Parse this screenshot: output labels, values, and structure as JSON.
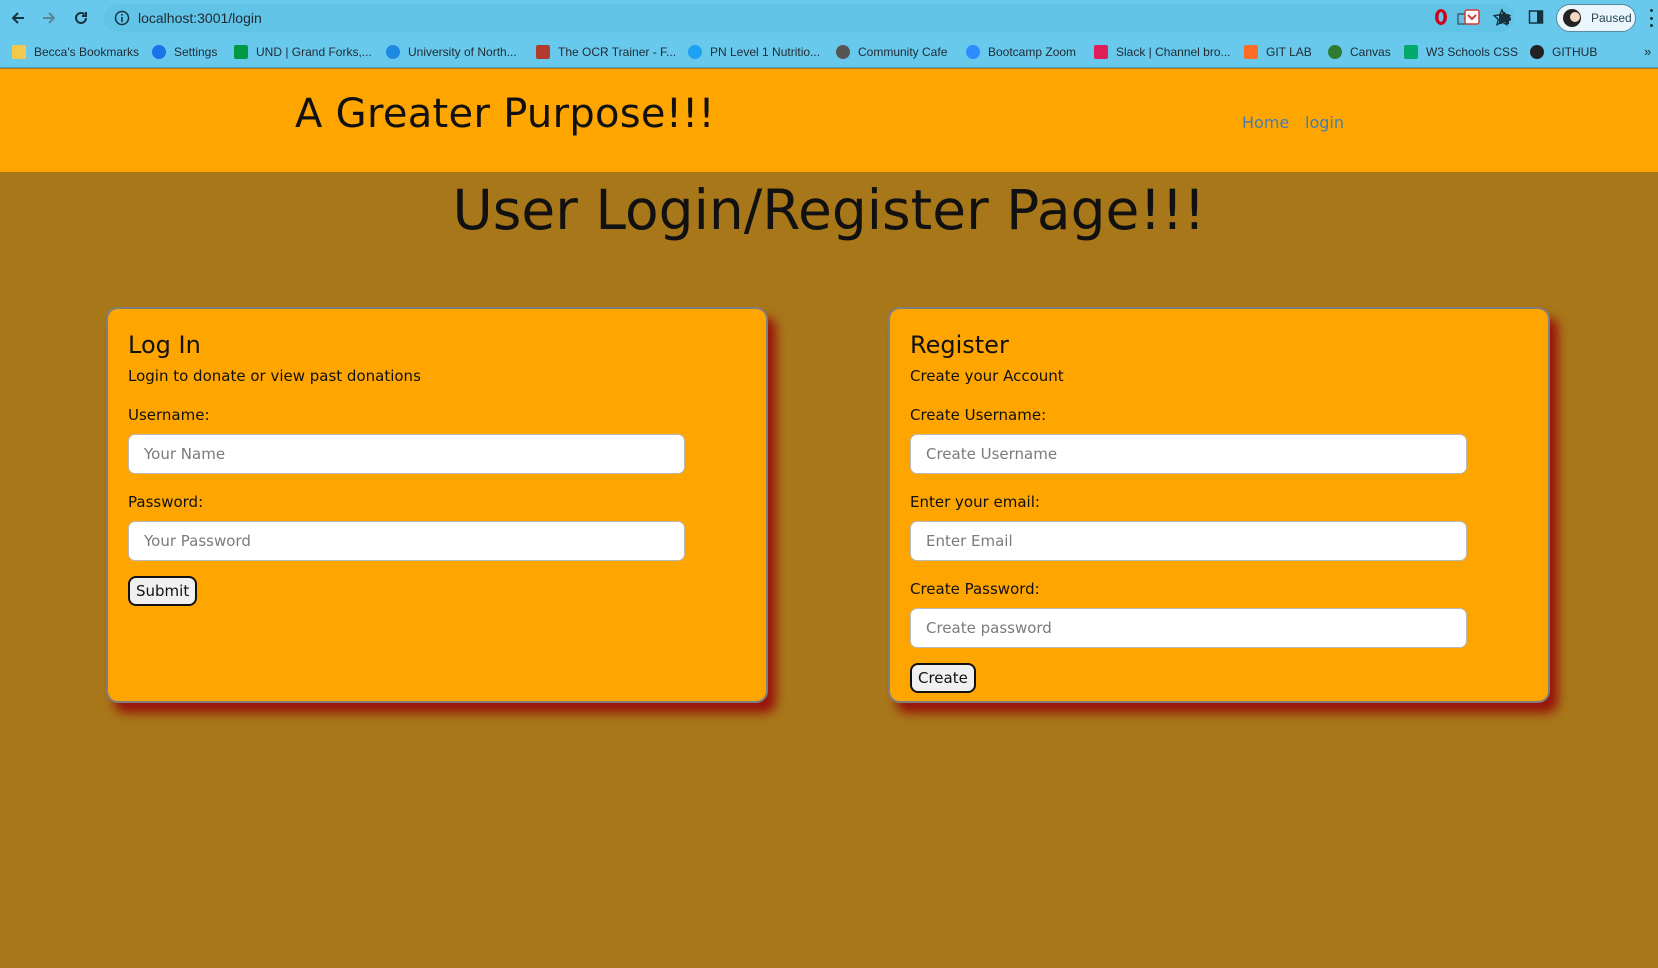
{
  "browser": {
    "url": "localhost:3001/login",
    "profile_status": "Paused"
  },
  "bookmarks": [
    {
      "label": "Becca's Bookmarks",
      "icon": "folder-icon",
      "color": "#f2c94c"
    },
    {
      "label": "Settings",
      "icon": "gear-icon",
      "color": "#1a73e8"
    },
    {
      "label": "UND | Grand Forks,...",
      "icon": "und-icon",
      "color": "#009a44"
    },
    {
      "label": "University of North...",
      "icon": "cloud-icon",
      "color": "#1e88e5"
    },
    {
      "label": "The OCR Trainer - F...",
      "icon": "ocr-icon",
      "color": "#b23a2e"
    },
    {
      "label": "PN Level 1 Nutritio...",
      "icon": "pn-icon",
      "color": "#1da1f2"
    },
    {
      "label": "Community Cafe",
      "icon": "chrome-icon",
      "color": "#555555"
    },
    {
      "label": "Bootcamp Zoom",
      "icon": "zoom-icon",
      "color": "#2d8cff"
    },
    {
      "label": "Slack | Channel bro...",
      "icon": "slack-icon",
      "color": "#e01e5a"
    },
    {
      "label": "GIT LAB",
      "icon": "gitlab-icon",
      "color": "#fc6d26"
    },
    {
      "label": "Canvas",
      "icon": "canvas-icon",
      "color": "#2e7d32"
    },
    {
      "label": "W3 Schools CSS",
      "icon": "w3schools-icon",
      "color": "#04aa6d"
    },
    {
      "label": "GITHUB",
      "icon": "github-icon",
      "color": "#222222"
    }
  ],
  "header": {
    "brand": "A Greater Purpose!!!",
    "nav": [
      {
        "label": "Home"
      },
      {
        "label": "login"
      }
    ]
  },
  "page": {
    "title": "User Login/Register Page!!!"
  },
  "login_card": {
    "title": "Log In",
    "subtitle": "Login to donate or view past donations",
    "username_label": "Username:",
    "username_placeholder": "Your Name",
    "password_label": "Password:",
    "password_placeholder": "Your Password",
    "submit_label": "Submit"
  },
  "register_card": {
    "title": "Register",
    "subtitle": "Create your Account",
    "username_label": "Create Username:",
    "username_placeholder": "Create Username",
    "email_label": "Enter your email:",
    "email_placeholder": "Enter Email",
    "password_label": "Create Password:",
    "password_placeholder": "Create password",
    "create_label": "Create"
  },
  "colors": {
    "page_background": "#a8771a",
    "header_background": "#ffa500",
    "card_background": "#ffa500",
    "card_shadow": "#960a0a",
    "nav_link": "#3e7fb8",
    "browser_chrome": "#68c9ec"
  }
}
